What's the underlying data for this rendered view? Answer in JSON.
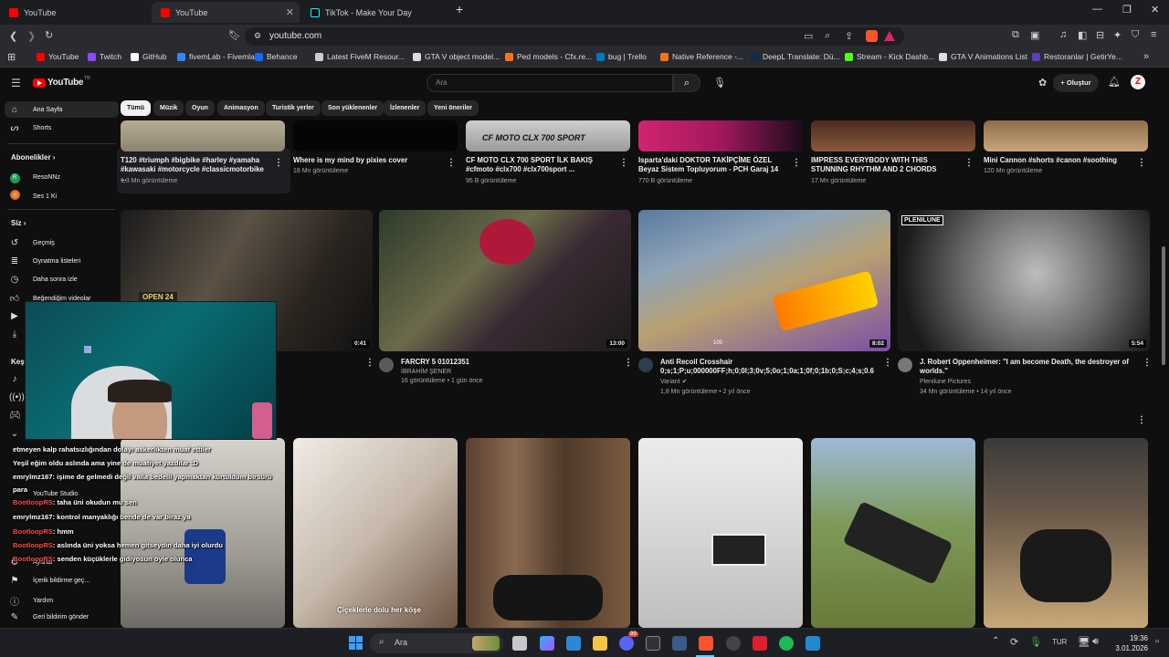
{
  "tabs": [
    {
      "label": "YouTube",
      "icon": "youtube-icon"
    },
    {
      "label": "YouTube",
      "icon": "youtube-icon"
    },
    {
      "label": "TikTok - Make Your Day",
      "icon": "tiktok-icon"
    }
  ],
  "address": {
    "url": "youtube.com"
  },
  "bookmarks": [
    {
      "label": "YouTube",
      "color": "#ff0000"
    },
    {
      "label": "Twitch",
      "color": "#9146ff"
    },
    {
      "label": "GitHub",
      "color": "#ffffff"
    },
    {
      "label": "fivemLab - Fivemlab",
      "color": "#3b82f6"
    },
    {
      "label": "Behance",
      "color": "#1769ff"
    },
    {
      "label": "Latest FiveM Resour...",
      "color": "#cccccc"
    },
    {
      "label": "GTA V object model...",
      "color": "#dddddd"
    },
    {
      "label": "Ped models - Cfx.re...",
      "color": "#f97316"
    },
    {
      "label": "bug | Trello",
      "color": "#0079bf"
    },
    {
      "label": "Native Reference -...",
      "color": "#f97316"
    },
    {
      "label": "DeepL Translate: Dü...",
      "color": "#0f2b46"
    },
    {
      "label": "Stream - Kick Dashb...",
      "color": "#53fc18"
    },
    {
      "label": "GTA V Animations List",
      "color": "#dddddd"
    },
    {
      "label": "Restoranlar | GetirYe...",
      "color": "#5d3ebc"
    }
  ],
  "yt": {
    "logo": "YouTube",
    "logo_sup": "TR",
    "search_placeholder": "Ara",
    "create_label": "Oluştur"
  },
  "sidebar": {
    "home": "Ana Sayfa",
    "shorts": "Shorts",
    "subs_header": "Abonelikler",
    "subs": [
      {
        "label": "ResoNNz",
        "color": "#1e9e55",
        "initial": "R"
      },
      {
        "label": "Ses 1 Ki",
        "color": "#c0392b",
        "initial": ""
      }
    ],
    "you_header": "Siz",
    "you_items": [
      "Geçmiş",
      "Oynatma listeleri",
      "Daha sonra izle",
      "Beğendiğim videolar"
    ],
    "explore_header": "Keşf",
    "bottom_items": [
      "YouTube Studio",
      "Ayarlar",
      "İçerik bildirme geç...",
      "Yardım",
      "Geri bildirim gönder"
    ]
  },
  "chips": [
    "Tümü",
    "Müzik",
    "Oyun",
    "Animasyon",
    "Turistik yerler",
    "Son yüklenenler",
    "İzlenenler",
    "Yeni öneriler"
  ],
  "row1": [
    {
      "title": "T120 #triumph #bigbike #harley #yamaha #kawasaki #motorcycle #classicmotorbike ...",
      "meta": "1,3 Mn görüntüleme",
      "thumb_text": ""
    },
    {
      "title": "Where is my mind by pixies cover",
      "meta": "18 Mn görüntüleme",
      "thumb_text": ""
    },
    {
      "title": "CF MOTO CLX 700 SPORT İLK BAKIŞ #cfmoto #clx700 #clx700sport ...",
      "meta": "95 B görüntüleme",
      "thumb_text": "CF MOTO CLX 700 SPORT"
    },
    {
      "title": "Isparta'daki DOKTOR TAKİPÇİME ÖZEL Beyaz Sistem Topluyorum - PCH Garaj 14",
      "meta": "770 B görüntüleme",
      "thumb_text": ""
    },
    {
      "title": "IMPRESS EVERYBODY WITH THIS STUNNING RHYTHM AND 2 CHORDS",
      "meta": "17 Mn görüntüleme",
      "thumb_text": ""
    },
    {
      "title": "Mini Cannon #shorts #canon #soothing",
      "meta": "120 Mn görüntüleme",
      "thumb_text": ""
    }
  ],
  "row2": [
    {
      "title": "",
      "channel": "",
      "meta": "",
      "duration": "0:41",
      "thumb_text": "OPEN 24"
    },
    {
      "title": "FARCRY 5 01012351",
      "channel": "İBRAHİM ŞENER",
      "meta": "16 görüntüleme • 1 gün önce",
      "duration": "13:00",
      "thumb_text": ""
    },
    {
      "title": "Anti Recoil Crosshair 0;s;1;P;u;000000FF;h;0;0l;3;0v;5;0o;1;0a;1;0f;0;1b;0;S;c;4;s;0.6",
      "channel": "Variant",
      "meta": "1,8 Mn görüntüleme • 2 yıl önce",
      "duration": "8:02",
      "thumb_text": "100"
    },
    {
      "title": "J. Robert Oppenheimer: \"I am become Death, the destroyer of worlds.\"",
      "channel": "Plenilune Pictures",
      "meta": "34 Mn görüntüleme • 14 yıl önce",
      "duration": "5:54",
      "thumb_text": "PLENILUNE"
    }
  ],
  "row3_caption": "Çiçeklerle dolu her köşe",
  "chat": [
    {
      "user": "",
      "text": "etmeyen kalp rahatsızlığından dolayı askerlikten muaf ettiler"
    },
    {
      "user": "",
      "text": "Yeşil eğim oldu aslında ama yine de muafiyet yazdılar :D"
    },
    {
      "user": "emrylmz167",
      "text": ": işime de gelmedi değil valla bedelli yapmaktan kurtuldum birsürü"
    },
    {
      "user": "",
      "text": "para"
    },
    {
      "user": "BootloopRS",
      "text": ": taha üni okudun mu sen"
    },
    {
      "user": "emrylmz167",
      "text": ": kontrol manyaklığı bende de var biraz ya"
    },
    {
      "user": "BootloopRS",
      "text": ": hmm"
    },
    {
      "user": "BootloopRS",
      "text": ": aslında üni yoksa hemen gitseydin daha iyi olurdu"
    },
    {
      "user": "BootloopRS",
      "text": ": senden küçüklerle gidiyosun öyle olunca"
    }
  ],
  "taskbar": {
    "search": "Ara",
    "lang": "TUR",
    "time": "19:36",
    "date": "3.01.2026",
    "badge": "99"
  },
  "colors": {
    "youtube_red": "#ff0000",
    "bg": "#0f0f0f",
    "chat_user": "#ff4c4c"
  }
}
